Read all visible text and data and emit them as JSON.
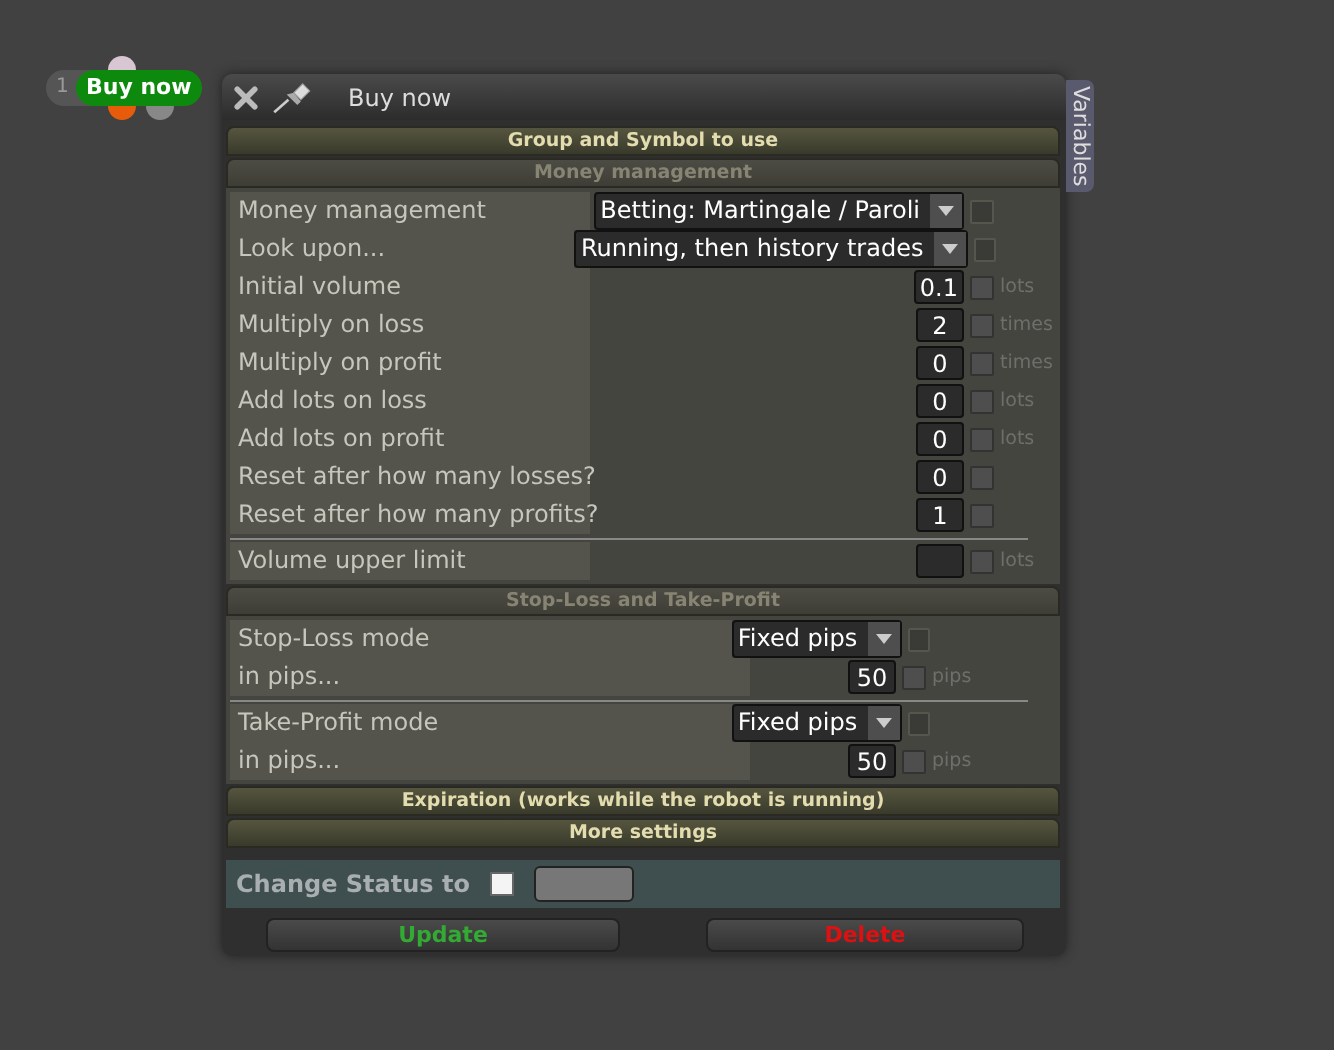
{
  "badge": {
    "number": "1",
    "label": "Buy now"
  },
  "window": {
    "title": "Buy now",
    "side_tab": "Variables"
  },
  "sections": [
    {
      "title": "Group and Symbol to use",
      "expanded": false
    },
    {
      "title": "Money management",
      "expanded": true,
      "blocks": [
        [
          {
            "kind": "select",
            "label": "Money management",
            "value": "Betting: Martingale / Paroli",
            "checked": false,
            "disabled": true
          },
          {
            "kind": "select",
            "label": "Look upon...",
            "value": "Running, then history trades",
            "checked": false,
            "disabled": true
          },
          {
            "kind": "number",
            "label": "Initial volume",
            "value": "0.1",
            "unit": "lots",
            "checked": false,
            "disabled": false
          },
          {
            "kind": "number",
            "label": "Multiply on loss",
            "value": "2",
            "unit": "times",
            "checked": false,
            "disabled": false
          },
          {
            "kind": "number",
            "label": "Multiply on profit",
            "value": "0",
            "unit": "times",
            "checked": false,
            "disabled": false
          },
          {
            "kind": "number",
            "label": "Add lots on loss",
            "value": "0",
            "unit": "lots",
            "checked": false,
            "disabled": false
          },
          {
            "kind": "number",
            "label": "Add lots on profit",
            "value": "0",
            "unit": "lots",
            "checked": false,
            "disabled": false
          },
          {
            "kind": "number",
            "label": "Reset after how many losses?",
            "value": "0",
            "checked": false,
            "disabled": false
          },
          {
            "kind": "number",
            "label": "Reset after how many profits?",
            "value": "1",
            "checked": false,
            "disabled": false
          }
        ],
        [
          {
            "kind": "number",
            "label": "Volume upper limit",
            "unit": "lots",
            "checked": false,
            "disabled": false
          }
        ]
      ]
    },
    {
      "title": "Stop-Loss and Take-Profit",
      "expanded": true,
      "blocks": [
        [
          {
            "kind": "select",
            "label": "Stop-Loss mode",
            "value": "Fixed pips",
            "checked": false,
            "disabled": true
          },
          {
            "kind": "number",
            "label": "in pips...",
            "value": "50",
            "unit": "pips",
            "checked": false,
            "disabled": false
          }
        ],
        [
          {
            "kind": "select",
            "label": "Take-Profit mode",
            "value": "Fixed pips",
            "checked": false,
            "disabled": true
          },
          {
            "kind": "number",
            "label": "in pips...",
            "value": "50",
            "unit": "pips",
            "checked": false,
            "disabled": false
          }
        ]
      ]
    },
    {
      "title": "Expiration (works while the robot is running)",
      "expanded": false
    },
    {
      "title": "More settings",
      "expanded": false
    }
  ],
  "status": {
    "label": "Change Status to",
    "checked": false
  },
  "buttons": [
    {
      "label": "Update",
      "kind": "confirm"
    },
    {
      "label": "Delete",
      "kind": "danger"
    }
  ]
}
